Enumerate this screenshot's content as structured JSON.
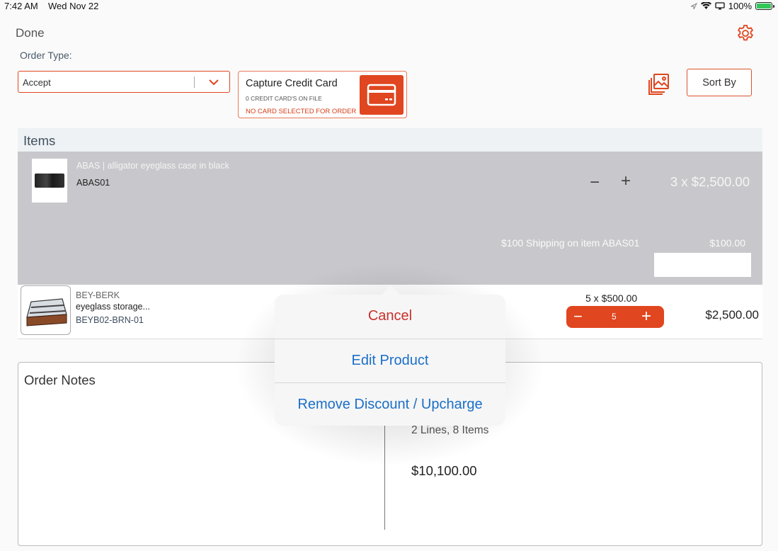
{
  "status_bar": {
    "time": "7:42 AM",
    "date": "Wed Nov 22",
    "battery": "100%",
    "icons": [
      "location-icon",
      "wifi-icon",
      "screen-mirror-icon",
      "battery-icon"
    ]
  },
  "header": {
    "done_label": "Done",
    "settings_icon": "gear-icon"
  },
  "order_type": {
    "label": "Order Type:",
    "selected": "Accept"
  },
  "credit_card": {
    "title": "Capture Credit Card",
    "on_file": "0 CREDIT CARD'S ON FILE",
    "warning": "NO CARD SELECTED FOR ORDER",
    "icon": "credit-card-icon"
  },
  "toolbar": {
    "gallery_icon": "image-gallery-icon",
    "sort_label": "Sort By"
  },
  "items": {
    "header": "Items",
    "rows": [
      {
        "name": "ABAS | alligator eyeglass case in black",
        "sku": "ABAS01",
        "qty_price": "3 x $2,500.00",
        "shipping_label": "$100 Shipping on item ABAS01",
        "shipping_amount": "$100.00"
      },
      {
        "brand": "BEY-BERK",
        "name": "eyeglass storage...",
        "sku": "BEYB02-BRN-01",
        "unit_line": "5 x $500.00",
        "qty": "5",
        "total": "$2,500.00"
      }
    ]
  },
  "notes": {
    "title": "Order Notes",
    "summary_lines": "2 Lines, 8 Items",
    "grand_total": "$10,100.00"
  },
  "popover": {
    "cancel": "Cancel",
    "edit": "Edit Product",
    "remove": "Remove Discount / Upcharge"
  },
  "colors": {
    "accent": "#e0461f",
    "link": "#1a6fc9",
    "destructive": "#c9302c",
    "selected_row": "#c8c8cc"
  }
}
